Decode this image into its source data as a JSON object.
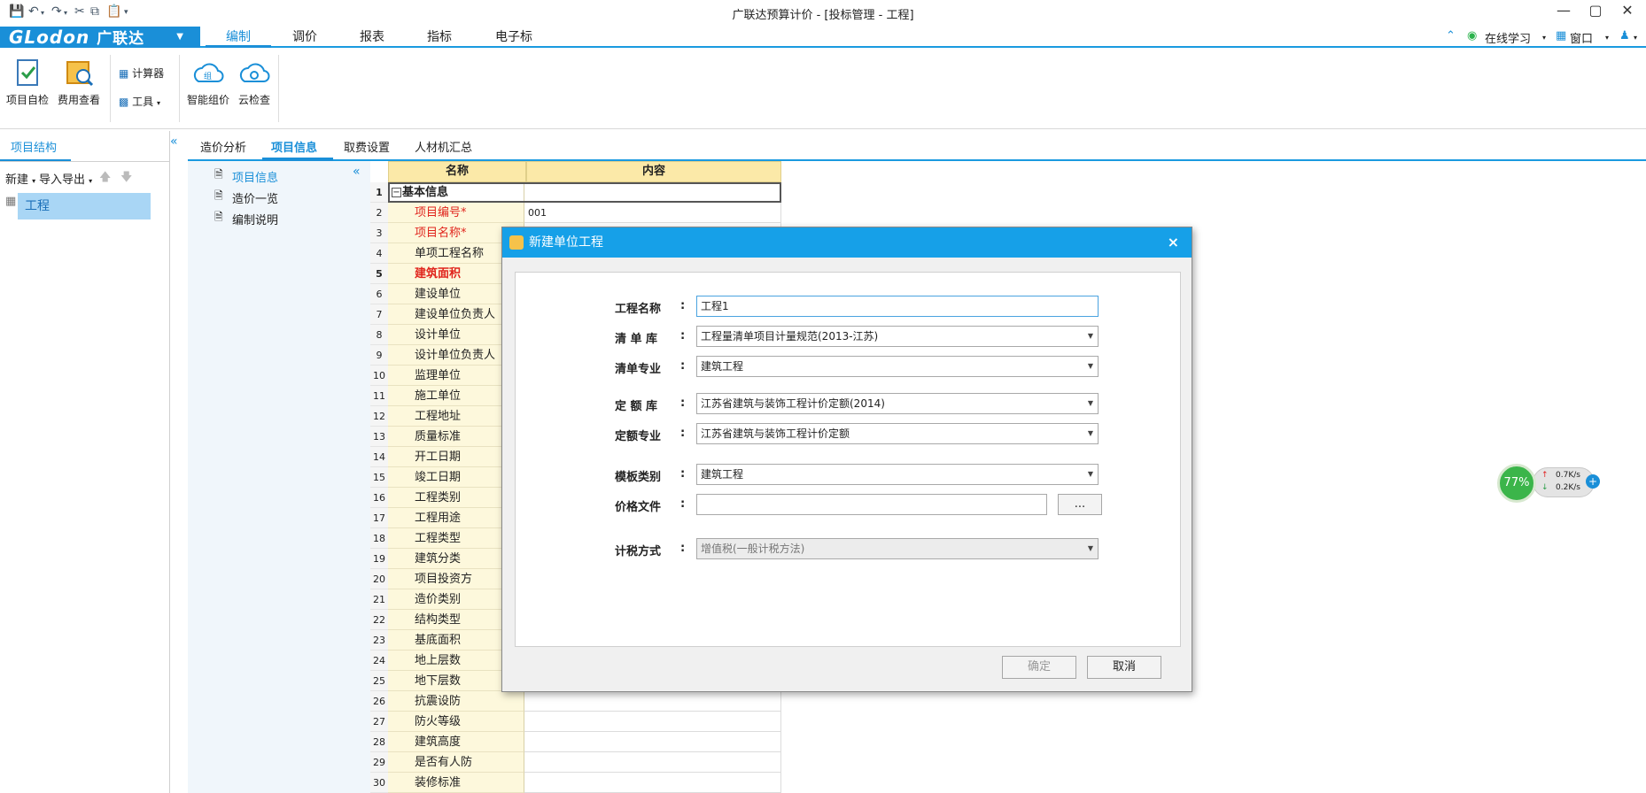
{
  "window": {
    "title": "广联达预算计价 - [投标管理 - 工程]"
  },
  "menu": {
    "logo_text": "GLodon",
    "logo_cn": "广联达",
    "tabs": [
      "编制",
      "调价",
      "报表",
      "指标",
      "电子标"
    ],
    "active_tab": "编制",
    "right": {
      "online_learning": "在线学习",
      "window": "窗口"
    }
  },
  "ribbon": {
    "self_check": "项目自检",
    "fee_view": "费用查看",
    "calculator": "计算器",
    "tools": "工具",
    "smart_pricing": "智能组价",
    "cloud_check": "云检查"
  },
  "left_panel": {
    "title": "项目结构",
    "new_label": "新建",
    "import_export": "导入导出",
    "tree_item": "工程"
  },
  "tabs": [
    "造价分析",
    "项目信息",
    "取费设置",
    "人材机汇总"
  ],
  "active_tab": "项目信息",
  "nav": [
    "项目信息",
    "造价一览",
    "编制说明"
  ],
  "grid": {
    "headers": {
      "name": "名称",
      "content": "内容"
    },
    "rows": [
      {
        "n": "1",
        "name": "基本信息",
        "val": ""
      },
      {
        "n": "2",
        "name": "项目编号*",
        "val": "001"
      },
      {
        "n": "3",
        "name": "项目名称*",
        "val": ""
      },
      {
        "n": "4",
        "name": "单项工程名称",
        "val": ""
      },
      {
        "n": "5",
        "name": "建筑面积",
        "val": ""
      },
      {
        "n": "6",
        "name": "建设单位",
        "val": ""
      },
      {
        "n": "7",
        "name": "建设单位负责人",
        "val": ""
      },
      {
        "n": "8",
        "name": "设计单位",
        "val": ""
      },
      {
        "n": "9",
        "name": "设计单位负责人",
        "val": ""
      },
      {
        "n": "10",
        "name": "监理单位",
        "val": ""
      },
      {
        "n": "11",
        "name": "施工单位",
        "val": ""
      },
      {
        "n": "12",
        "name": "工程地址",
        "val": ""
      },
      {
        "n": "13",
        "name": "质量标准",
        "val": ""
      },
      {
        "n": "14",
        "name": "开工日期",
        "val": ""
      },
      {
        "n": "15",
        "name": "竣工日期",
        "val": ""
      },
      {
        "n": "16",
        "name": "工程类别",
        "val": ""
      },
      {
        "n": "17",
        "name": "工程用途",
        "val": ""
      },
      {
        "n": "18",
        "name": "工程类型",
        "val": ""
      },
      {
        "n": "19",
        "name": "建筑分类",
        "val": ""
      },
      {
        "n": "20",
        "name": "项目投资方",
        "val": ""
      },
      {
        "n": "21",
        "name": "造价类别",
        "val": ""
      },
      {
        "n": "22",
        "name": "结构类型",
        "val": ""
      },
      {
        "n": "23",
        "name": "基底面积",
        "val": ""
      },
      {
        "n": "24",
        "name": "地上层数",
        "val": ""
      },
      {
        "n": "25",
        "name": "地下层数",
        "val": ""
      },
      {
        "n": "26",
        "name": "抗震设防",
        "val": ""
      },
      {
        "n": "27",
        "name": "防火等级",
        "val": ""
      },
      {
        "n": "28",
        "name": "建筑高度",
        "val": ""
      },
      {
        "n": "29",
        "name": "是否有人防",
        "val": ""
      },
      {
        "n": "30",
        "name": "装修标准",
        "val": ""
      }
    ],
    "required_color": "#e0241c"
  },
  "dialog": {
    "title": "新建单位工程",
    "fields": {
      "project_name_label": "工程名称",
      "project_name_value": "工程1",
      "list_lib_label": "清 单 库",
      "list_lib_value": "工程量清单项目计量规范(2013-江苏)",
      "list_major_label": "清单专业",
      "list_major_value": "建筑工程",
      "quota_lib_label": "定 额 库",
      "quota_lib_value": "江苏省建筑与装饰工程计价定额(2014)",
      "quota_major_label": "定额专业",
      "quota_major_value": "江苏省建筑与装饰工程计价定额",
      "template_label": "模板类别",
      "template_value": "建筑工程",
      "price_file_label": "价格文件",
      "price_file_value": "",
      "browse_label": "...",
      "tax_label": "计税方式",
      "tax_value": "增值税(一般计税方法)"
    },
    "ok_label": "确定",
    "cancel_label": "取消"
  },
  "speed_widget": {
    "percent": "77%",
    "up": "0.7K/s",
    "down": "0.2K/s"
  },
  "colors": {
    "accent": "#1a8fd8",
    "dialog_title": "#16a0e8",
    "grid_header": "#fbe9a8"
  }
}
